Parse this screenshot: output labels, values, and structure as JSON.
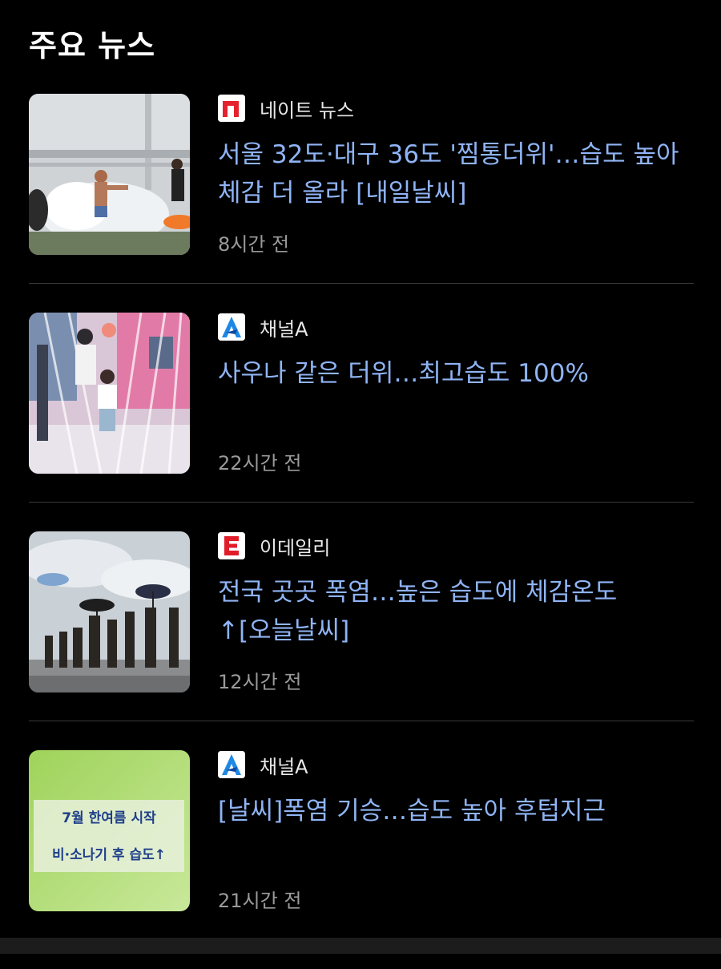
{
  "section": {
    "title": "주요 뉴스"
  },
  "colors": {
    "background": "#000000",
    "headline": "#8fb4f5",
    "source_text": "#e8e8e8",
    "timestamp": "#9a9a9a",
    "divider": "#3a3a3a",
    "nate_red": "#e5212e",
    "channel_a_blue": "#1e88e5",
    "edaily_red": "#e11d2a"
  },
  "news": [
    {
      "source": "네이트 뉴스",
      "source_icon": "nate-news-logo-icon",
      "headline": "서울 32도·대구 36도 '찜통더위'…습도 높아 체감 더 올라 [내일날씨]",
      "time": "8시간 전",
      "thumbnail": "water-splash-photo"
    },
    {
      "source": "채널A",
      "source_icon": "channel-a-logo-icon",
      "headline": "사우나 같은 더위…최고습도 100%",
      "time": "22시간 전",
      "thumbnail": "fountain-kids-photo"
    },
    {
      "source": "이데일리",
      "source_icon": "edaily-logo-icon",
      "headline": "전국 곳곳 폭염…높은 습도에 체감온도 ↑[오늘날씨]",
      "time": "12시간 전",
      "thumbnail": "umbrella-crowd-photo"
    },
    {
      "source": "채널A",
      "source_icon": "channel-a-logo-icon",
      "headline": "[날씨]폭염 기승…습도 높아 후텁지근",
      "time": "21시간 전",
      "thumbnail": "weather-card-graphic",
      "thumbnail_text": [
        "7월 한여름 시작",
        "비·소나기 후 습도↑"
      ]
    }
  ]
}
